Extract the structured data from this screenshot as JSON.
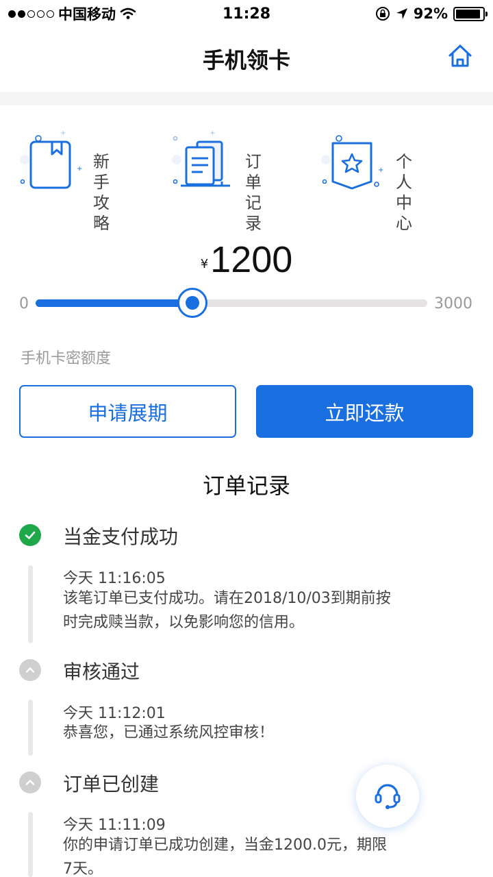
{
  "status_bar": {
    "carrier": "中国移动",
    "time": "11:28",
    "battery": "92%",
    "battery_level": 0.92
  },
  "nav": {
    "title": "手机领卡"
  },
  "quick_actions": [
    {
      "label": "新手攻略",
      "icon": "book-icon"
    },
    {
      "label": "订单记录",
      "icon": "document-icon"
    },
    {
      "label": "个人中心",
      "icon": "star-badge-icon"
    }
  ],
  "amount": {
    "symbol": "¥",
    "value": "1200"
  },
  "slider": {
    "min_label": "0",
    "max_label": "3000",
    "min": 0,
    "max": 3000,
    "value": 1200
  },
  "limit_label": "手机卡密额度",
  "buttons": {
    "extend": "申请展期",
    "repay": "立即还款"
  },
  "records": {
    "title": "订单记录",
    "items": [
      {
        "status": "done",
        "title": "当金支付成功",
        "time": "今天 11:16:05",
        "desc": "该笔订单已支付成功。请在2018/10/03到期前按时完成赎当款，以免影响您的信用。"
      },
      {
        "status": "collapsed",
        "title": "审核通过",
        "time": "今天 11:12:01",
        "desc": "恭喜您，已通过系统风控审核！"
      },
      {
        "status": "collapsed",
        "title": "订单已创建",
        "time": "今天 11:11:09",
        "desc": "你的申请订单已成功创建，当金1200.0元，期限7天。"
      }
    ]
  },
  "colors": {
    "primary": "#1a6fe0",
    "success": "#1ea84a"
  }
}
